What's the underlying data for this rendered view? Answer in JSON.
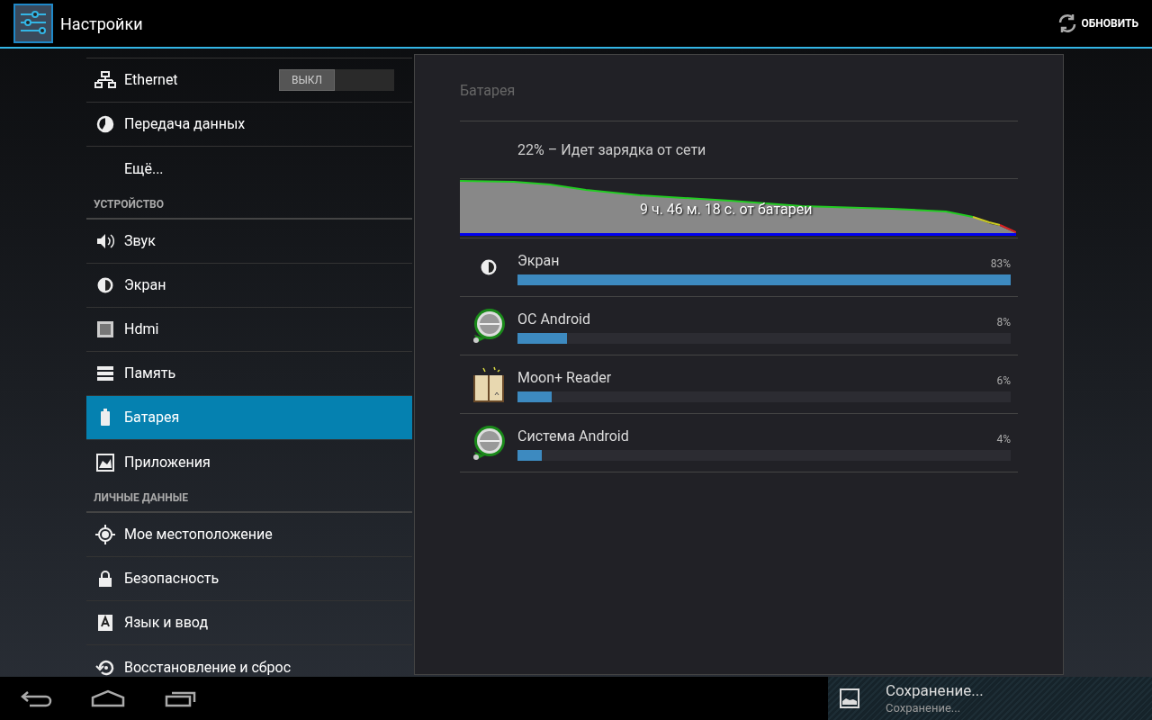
{
  "action_bar": {
    "title": "Настройки",
    "action": "ОБНОВИТЬ"
  },
  "sidebar": {
    "groups": [
      {
        "items": [
          {
            "label": "Ethernet",
            "selected": false,
            "toggle": {
              "label": "ВЫКЛ",
              "on": false
            }
          },
          {
            "label": "Передача данных",
            "selected": false
          },
          {
            "label": "Ещё...",
            "selected": false
          }
        ]
      },
      {
        "header": "УСТРОЙСТВО",
        "items": [
          {
            "label": "Звук",
            "selected": false
          },
          {
            "label": "Экран",
            "selected": false
          },
          {
            "label": "Hdmi",
            "selected": false
          },
          {
            "label": "Память",
            "selected": false
          },
          {
            "label": "Батарея",
            "selected": true
          },
          {
            "label": "Приложения",
            "selected": false
          }
        ]
      },
      {
        "header": "ЛИЧНЫЕ ДАННЫЕ",
        "items": [
          {
            "label": "Мое местоположение",
            "selected": false
          },
          {
            "label": "Безопасность",
            "selected": false
          },
          {
            "label": "Язык и ввод",
            "selected": false
          },
          {
            "label": "Восстановление и сброс",
            "selected": false
          }
        ]
      }
    ]
  },
  "battery": {
    "title": "Батарея",
    "status": "22% – Идет зарядка от сети",
    "graph_label": "9 ч. 46 м. 18 с. от батареи",
    "usage": [
      {
        "name": "Экран",
        "percent": "83%",
        "level": 1.0
      },
      {
        "name": "ОС Android",
        "percent": "8%",
        "level": 0.1
      },
      {
        "name": "Moon+ Reader",
        "percent": "6%",
        "level": 0.07
      },
      {
        "name": "Система Android",
        "percent": "4%",
        "level": 0.05
      }
    ]
  },
  "notification": {
    "title": "Сохранение...",
    "text": "Сохранение..."
  }
}
